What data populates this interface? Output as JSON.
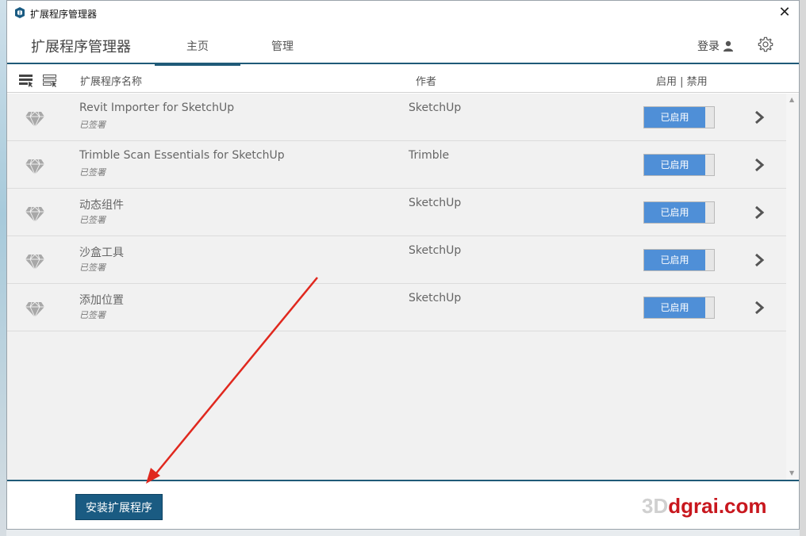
{
  "window": {
    "title": "扩展程序管理器",
    "close_glyph": "✕"
  },
  "header": {
    "app_name": "扩展程序管理器",
    "tabs": [
      {
        "label": "主页",
        "active": true
      },
      {
        "label": "管理",
        "active": false
      }
    ],
    "login_label": "登录",
    "login_icon": "user-icon",
    "settings_icon": "gear-icon"
  },
  "columns": {
    "name": "扩展程序名称",
    "author": "作者",
    "toggle": "启用 | 禁用"
  },
  "extensions": [
    {
      "name": "Revit Importer for SketchUp",
      "status": "已签署",
      "author": "SketchUp",
      "toggle_label": "已启用"
    },
    {
      "name": "Trimble Scan Essentials for SketchUp",
      "status": "已签署",
      "author": "Trimble",
      "toggle_label": "已启用"
    },
    {
      "name": "动态组件",
      "status": "已签署",
      "author": "SketchUp",
      "toggle_label": "已启用"
    },
    {
      "name": "沙盒工具",
      "status": "已签署",
      "author": "SketchUp",
      "toggle_label": "已启用"
    },
    {
      "name": "添加位置",
      "status": "已签署",
      "author": "SketchUp",
      "toggle_label": "已启用"
    }
  ],
  "footer": {
    "install_label": "安装扩展程序",
    "watermark_ghost": "3D",
    "watermark_text": "dgrai.com"
  },
  "colors": {
    "accent": "#1f5a78",
    "toggle_on": "#4f8fd7",
    "install_button": "#1a5b82",
    "annotation_arrow": "#e0281e",
    "watermark": "#c8171e"
  }
}
